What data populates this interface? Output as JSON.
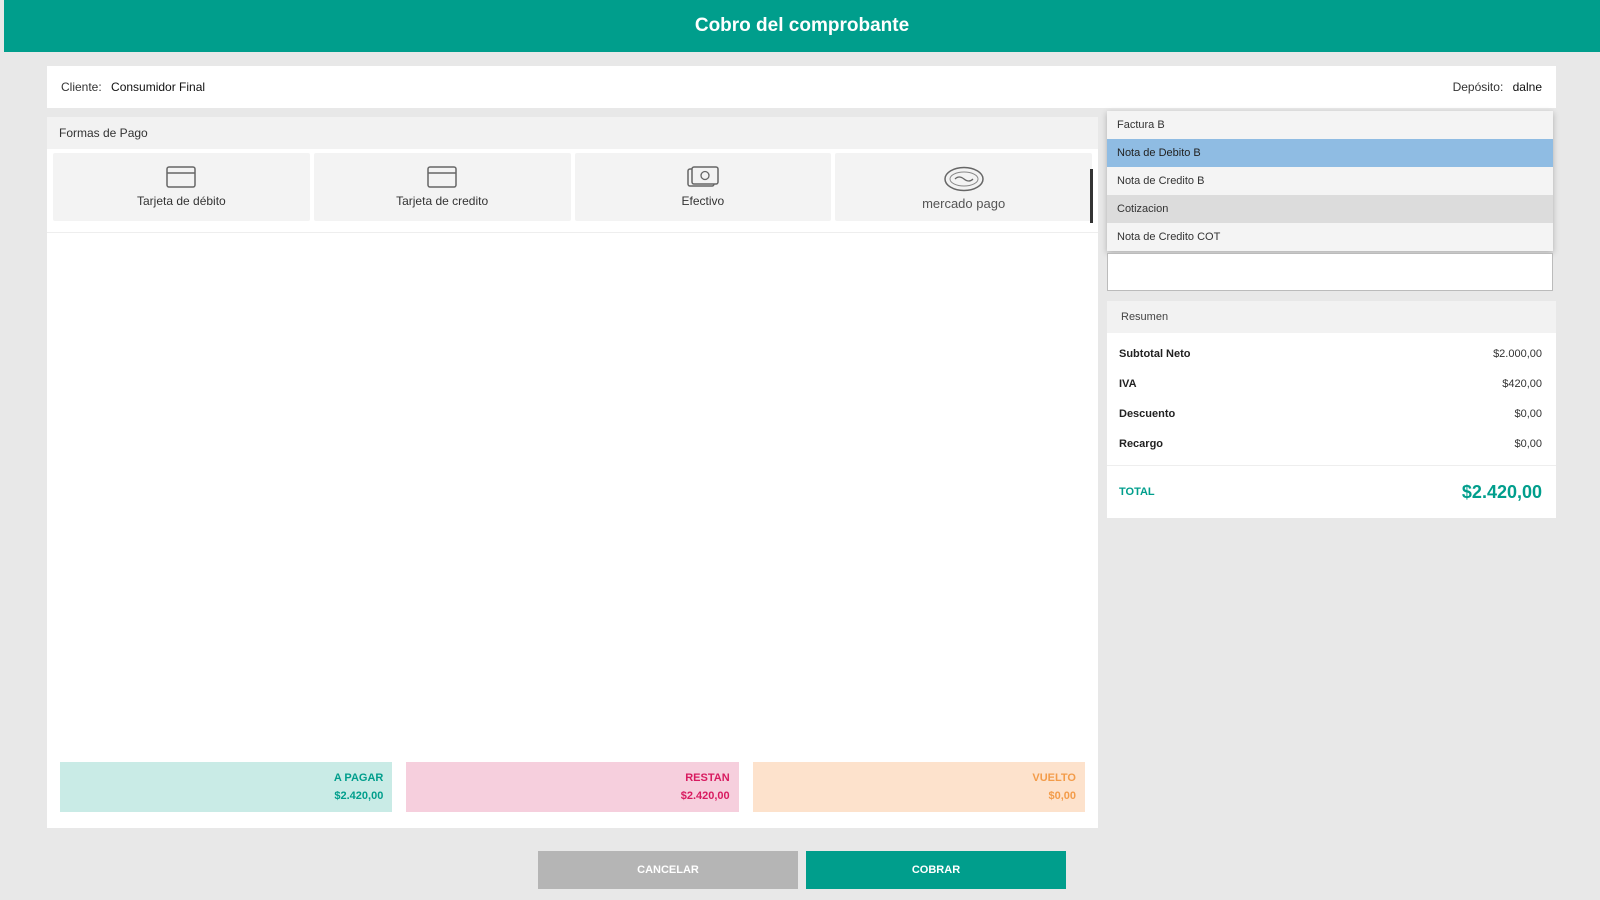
{
  "header": {
    "title": "Cobro del comprobante"
  },
  "client_bar": {
    "client_label": "Cliente:",
    "client_value": "Consumidor Final",
    "deposit_label": "Depósito:",
    "deposit_value": "dalne"
  },
  "payment": {
    "section_title": "Formas de Pago",
    "methods": [
      {
        "label": "Tarjeta de débito",
        "icon": "credit-card-icon"
      },
      {
        "label": "Tarjeta de credito",
        "icon": "credit-card-icon"
      },
      {
        "label": "Efectivo",
        "icon": "cash-icon"
      },
      {
        "label": "mercado pago",
        "icon": "mercado-pago-logo"
      }
    ]
  },
  "amounts": {
    "to_pay_label": "A PAGAR",
    "to_pay_value": "$2.420,00",
    "remaining_label": "RESTAN",
    "remaining_value": "$2.420,00",
    "change_label": "VUELTO",
    "change_value": "$0,00"
  },
  "voucher_dropdown": {
    "options": [
      "Factura B",
      "Nota de Debito B",
      "Nota de Credito B",
      "Cotizacion",
      "Nota de Credito COT"
    ],
    "selected_index": 1,
    "hover_index": 3
  },
  "summary": {
    "title": "Resumen",
    "rows": [
      {
        "label": "Subtotal Neto",
        "value": "$2.000,00"
      },
      {
        "label": "IVA",
        "value": "$420,00"
      },
      {
        "label": "Descuento",
        "value": "$0,00"
      },
      {
        "label": "Recargo",
        "value": "$0,00"
      }
    ],
    "total_label": "TOTAL",
    "total_value": "$2.420,00"
  },
  "buttons": {
    "cancel": "CANCELAR",
    "charge": "COBRAR"
  },
  "colors": {
    "primary": "#009e8c",
    "to_pay_bg": "#c9ebe6",
    "remaining_bg": "#f6cfdd",
    "remaining_text": "#d81b60",
    "change_bg": "#fde2cc",
    "change_text": "#f39c4a",
    "selected_option": "#8fbce3"
  }
}
